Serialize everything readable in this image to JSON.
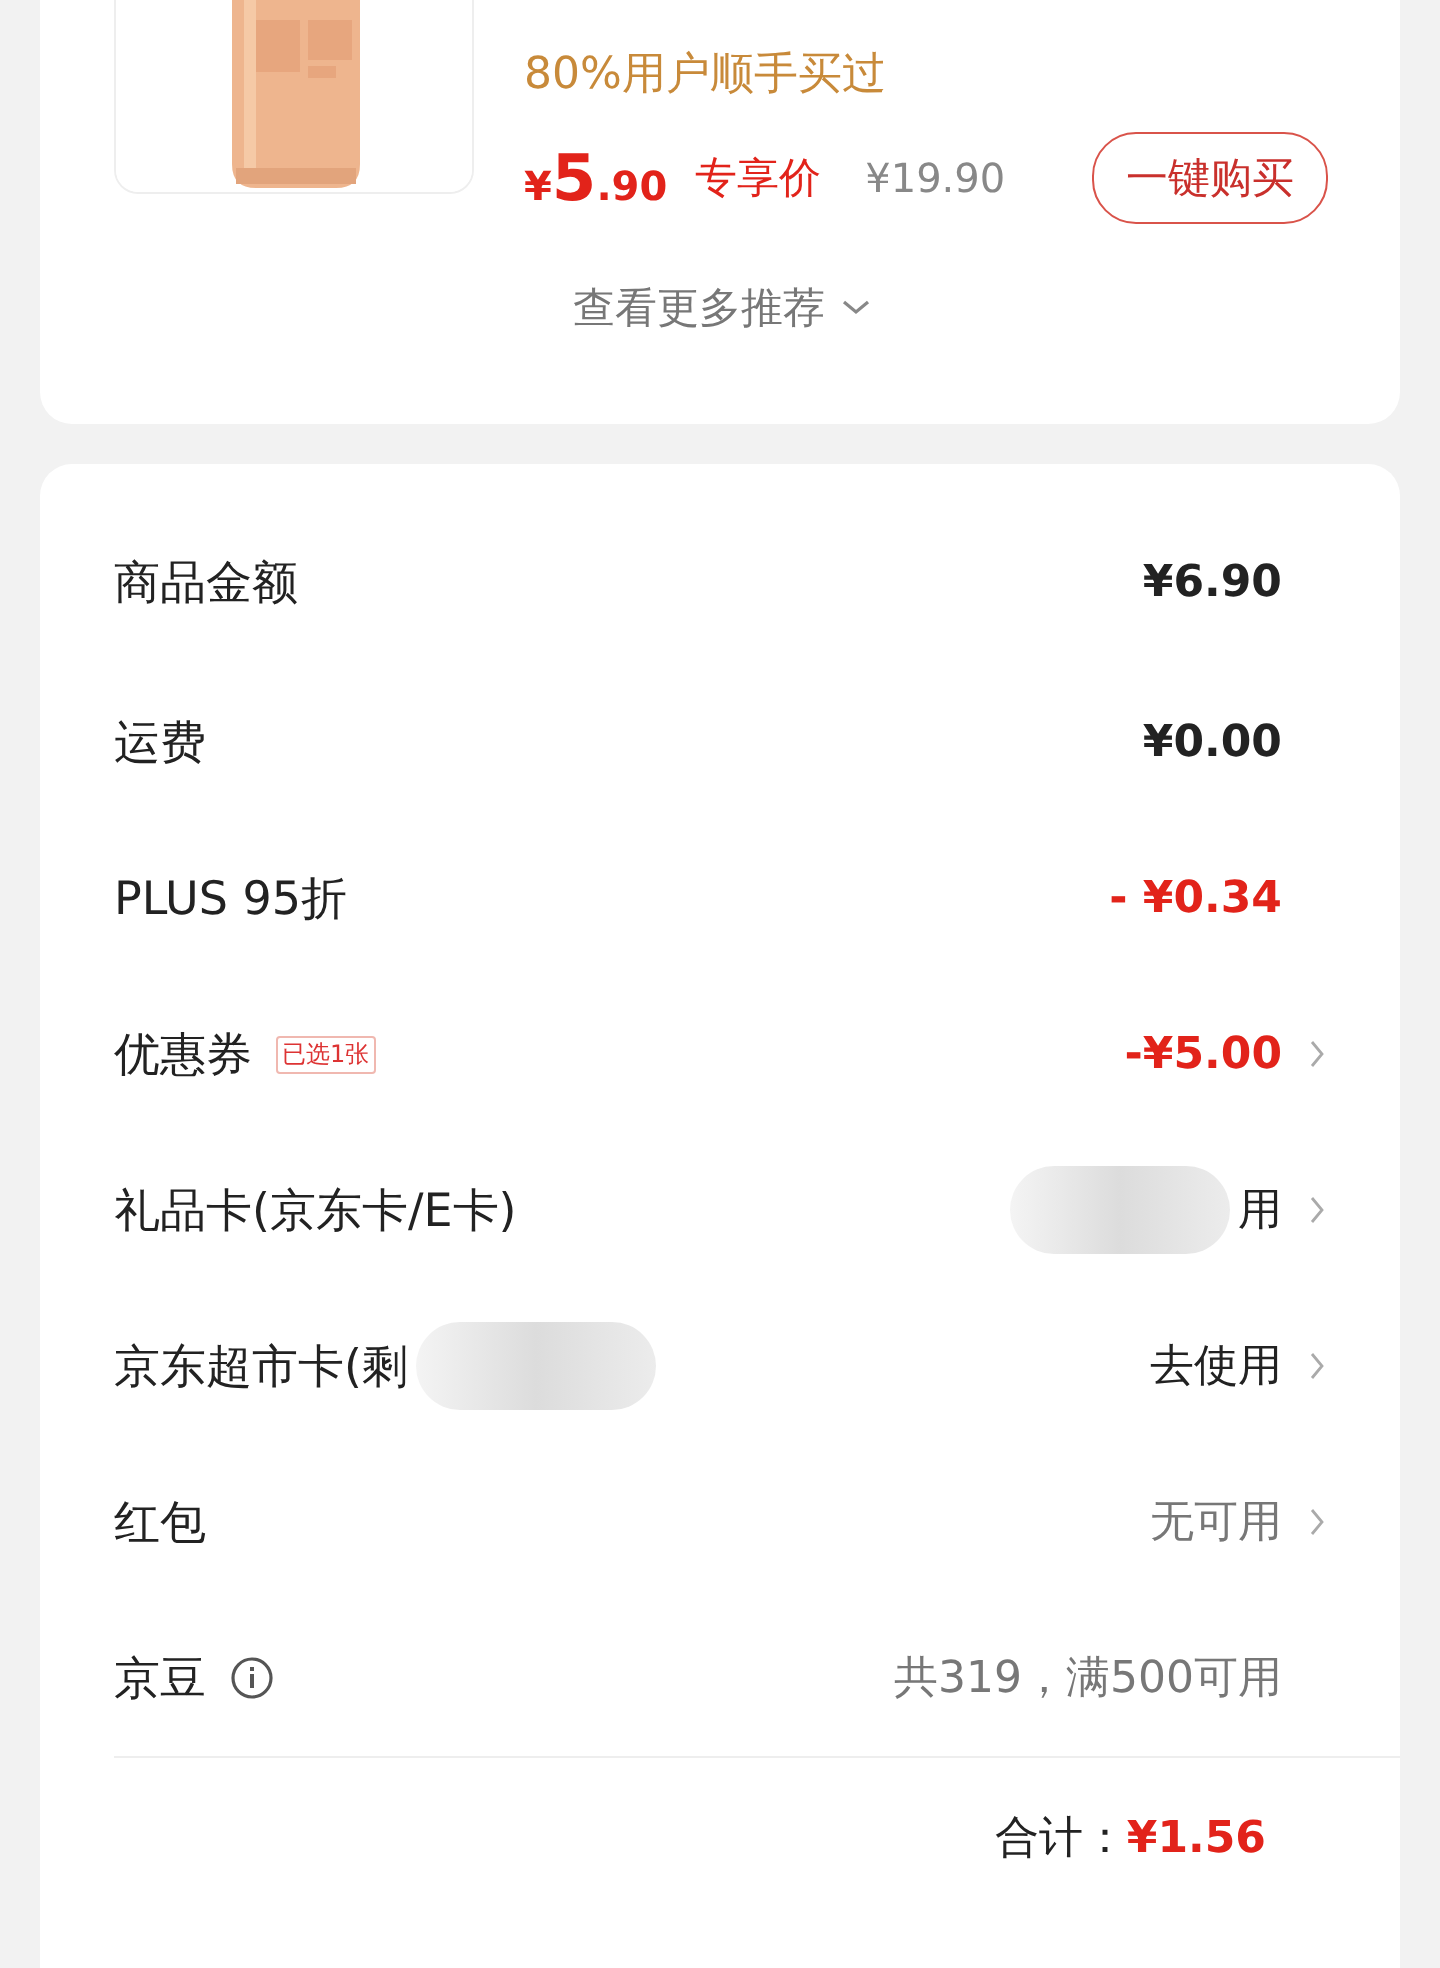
{
  "recommendation": {
    "note": "80%用户顺手买过",
    "price_symbol": "¥",
    "price_integer": "5",
    "price_decimal": ".90",
    "price_tag": "专享价",
    "original_price": "¥19.90",
    "buy_button": "一键购买",
    "more_link": "查看更多推荐"
  },
  "summary": {
    "rows": [
      {
        "label": "商品金额",
        "value": "¥6.90",
        "kind": "amount",
        "arrow": false,
        "info": false,
        "redacted_value": false,
        "redacted_label": false
      },
      {
        "label": "运费",
        "value": "¥0.00",
        "kind": "amount",
        "arrow": false,
        "info": false,
        "redacted_value": false,
        "redacted_label": false
      },
      {
        "label": "PLUS 95折",
        "value": "- ¥0.34",
        "kind": "discount",
        "arrow": false,
        "info": false,
        "redacted_value": false,
        "redacted_label": false
      },
      {
        "label": "优惠券",
        "badge": "已选1张",
        "value": "-¥5.00",
        "kind": "discount",
        "arrow": true,
        "info": false,
        "redacted_value": false,
        "redacted_label": false
      },
      {
        "label": "礼品卡(京东卡/E卡)",
        "value": "用",
        "kind": "action",
        "arrow": true,
        "info": false,
        "redacted_value": true,
        "redacted_label": false
      },
      {
        "label": "京东超市卡(剩",
        "value": "去使用",
        "kind": "action",
        "arrow": true,
        "info": false,
        "redacted_value": false,
        "redacted_label": true
      },
      {
        "label": "红包",
        "value": "无可用",
        "kind": "muted",
        "arrow": true,
        "info": false,
        "redacted_value": false,
        "redacted_label": false
      },
      {
        "label": "京豆",
        "value": "共319，满500可用",
        "kind": "muted",
        "arrow": false,
        "info": true,
        "redacted_value": false,
        "redacted_label": false
      }
    ],
    "total_label": "合计：",
    "total_value": "¥1.56"
  }
}
